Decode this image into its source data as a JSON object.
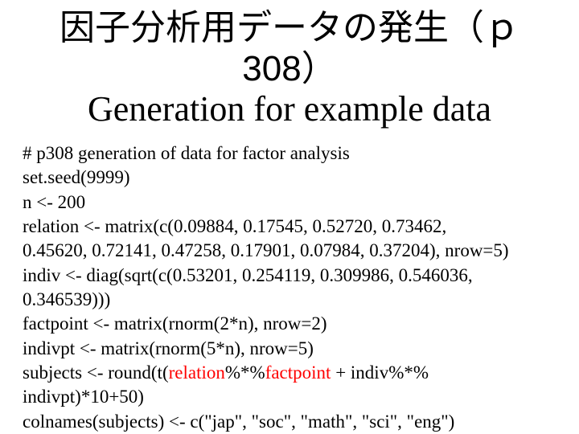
{
  "title": {
    "line1_jp": "因子分析用データの発生（ｐ308）",
    "line2_en": "Generation for example data"
  },
  "code": {
    "l1": "# p308 generation of data for factor analysis",
    "l2": "set.seed(9999)",
    "l3": "n <- 200",
    "l4": "relation <- matrix(c(0.09884, 0.17545, 0.52720, 0.73462,",
    "l5": "0.45620, 0.72141, 0.47258, 0.17901, 0.07984, 0.37204), nrow=5)",
    "l6": "indiv <- diag(sqrt(c(0.53201, 0.254119, 0.309986, 0.546036,",
    "l7": "0.346539)))",
    "l8": "factpoint <- matrix(rnorm(2*n), nrow=2)",
    "l9": "indivpt <- matrix(rnorm(5*n), nrow=5)",
    "l10a": "subjects <- round(t(",
    "l10_rel": "relation",
    "l10b": "%*%",
    "l10_fact": "factpoint",
    "l10c": " + indiv%*%",
    "l11": "indivpt)*10+50)",
    "l12": "colnames(subjects) <- c(\"jap\", \"soc\", \"math\", \"sci\", \"eng\")"
  }
}
